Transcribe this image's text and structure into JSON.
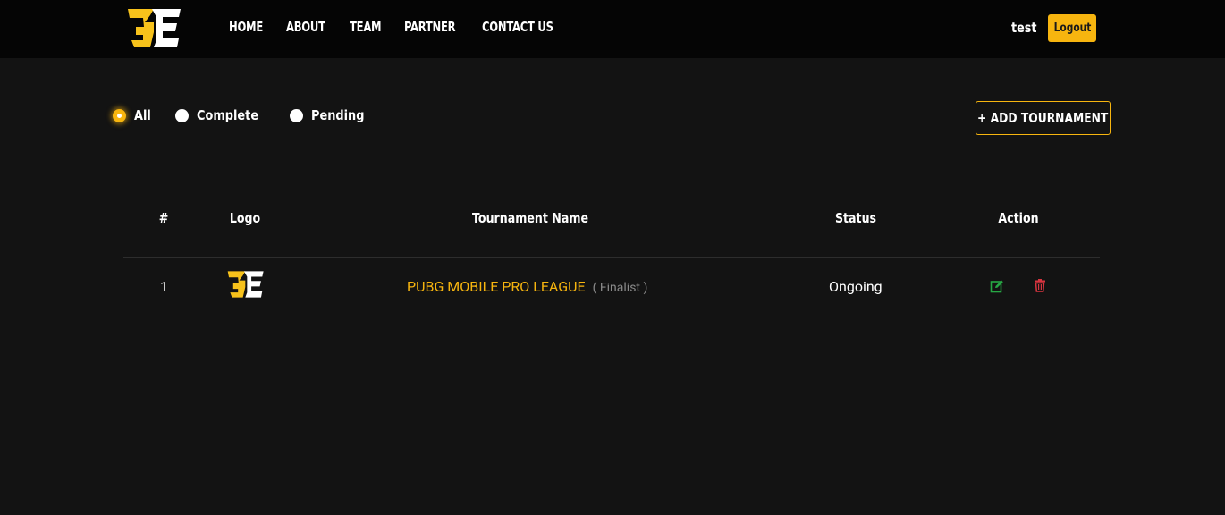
{
  "header": {
    "nav": [
      "HOME",
      "ABOUT",
      "TEAM",
      "PARTNER",
      "CONTACT US"
    ],
    "username": "test",
    "logout_label": "Logout"
  },
  "filters": {
    "options": [
      "All",
      "Complete",
      "Pending"
    ],
    "selected": "All"
  },
  "add_tournament_label": "+ ADD TOURNAMENT",
  "table": {
    "columns": [
      "#",
      "Logo",
      "Tournament Name",
      "Status",
      "Action"
    ],
    "rows": [
      {
        "index": "1",
        "name": "PUBG MOBILE PRO LEAGUE",
        "tag": "( Finalist )",
        "status": "Ongoing"
      }
    ]
  },
  "colors": {
    "accent": "#f7b50f",
    "background": "#131313",
    "header_bg": "#050505",
    "edit_icon": "#27a744",
    "delete_icon": "#d9343f"
  }
}
